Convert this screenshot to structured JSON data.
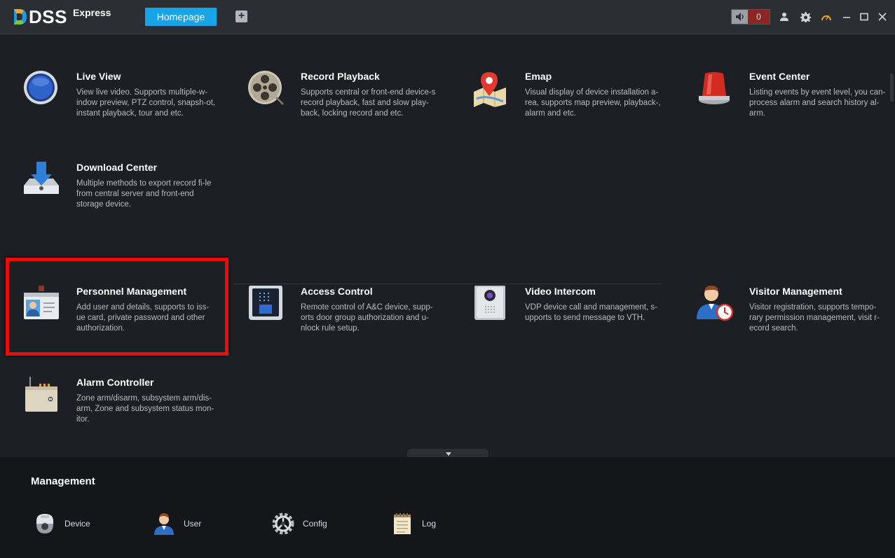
{
  "app": {
    "name": "DSS",
    "edition": "Express"
  },
  "tabs": [
    {
      "label": "Homepage"
    }
  ],
  "toolbar": {
    "alarm_count": "0"
  },
  "modules": [
    {
      "title": "Live View",
      "desc": "View live video. Supports multiple-w-indow preview, PTZ control, snapsh-ot, instant playback, tour and etc."
    },
    {
      "title": "Record Playback",
      "desc": "Supports central or front-end device-s record playback, fast and slow play-back, locking record and etc."
    },
    {
      "title": "Emap",
      "desc": "Visual display of device installation a-rea, supports map preview, playback-, alarm and etc."
    },
    {
      "title": "Event Center",
      "desc": "Listing events by event level, you can- process alarm and search history al-arm."
    },
    {
      "title": "Download Center",
      "desc": "Multiple methods to export record fi-le from central server and front-end storage device."
    },
    {
      "title": "Personnel Management",
      "desc": "Add user and details, supports to iss-ue card, private password and other authorization."
    },
    {
      "title": "Access Control",
      "desc": "Remote control of A&C device, supp-orts door group authorization and u-nlock rule setup."
    },
    {
      "title": "Video Intercom",
      "desc": "VDP device call and management, s-upports to send message to VTH."
    },
    {
      "title": "Visitor Management",
      "desc": "Visitor registration, supports tempo-rary permission management, visit r-ecord search."
    },
    {
      "title": "Alarm Controller",
      "desc": "Zone arm/disarm, subsystem arm/dis-arm, Zone and subsystem status mon-itor."
    }
  ],
  "management": {
    "title": "Management",
    "items": [
      {
        "label": "Device"
      },
      {
        "label": "User"
      },
      {
        "label": "Config"
      },
      {
        "label": "Log"
      }
    ]
  },
  "colors": {
    "accent": "#18a5e8",
    "highlight": "#ec0a0a",
    "background": "#1c1f23"
  }
}
